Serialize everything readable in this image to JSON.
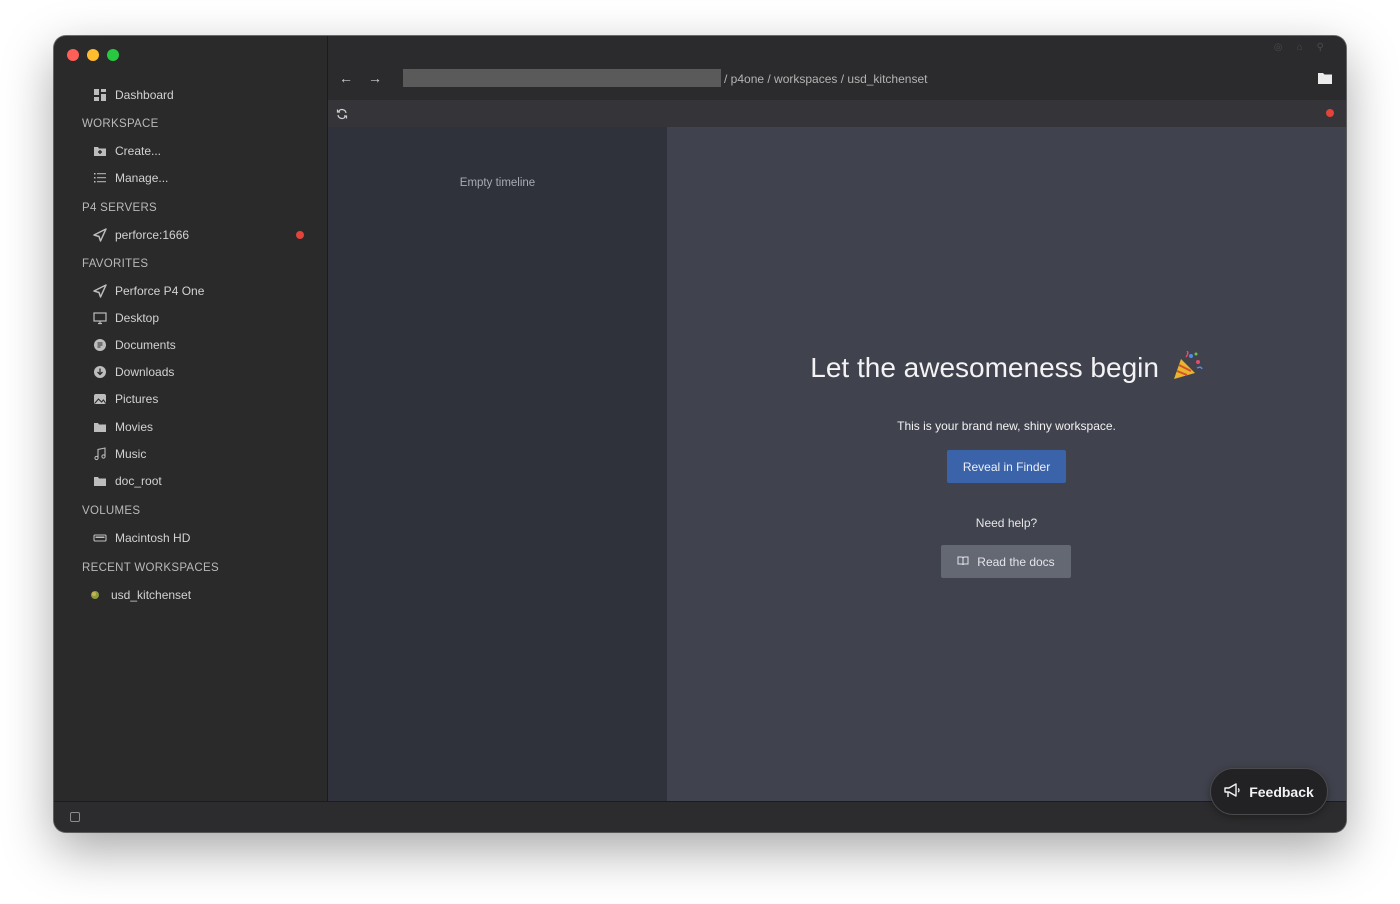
{
  "sidebar": {
    "dashboard": "Dashboard",
    "sections": {
      "workspace": "WORKSPACE",
      "servers": "P4 SERVERS",
      "favorites": "FAVORITES",
      "volumes": "VOLUMES",
      "recent": "RECENT WORKSPACES"
    },
    "workspace_items": [
      "Create...",
      "Manage..."
    ],
    "servers": [
      "perforce:1666"
    ],
    "favorites": [
      "Perforce P4 One",
      "Desktop",
      "Documents",
      "Downloads",
      "Pictures",
      "Movies",
      "Music",
      "doc_root"
    ],
    "volumes": [
      "Macintosh HD"
    ],
    "recent": [
      "usd_kitchenset"
    ]
  },
  "header": {
    "path": "/ p4one / workspaces / usd_kitchenset"
  },
  "timeline": {
    "empty_text": "Empty timeline"
  },
  "main": {
    "title": "Let the awesomeness begin",
    "subtitle": "This is your brand new, shiny workspace.",
    "reveal_button": "Reveal in Finder",
    "help_text": "Need help?",
    "docs_button": "Read the docs"
  },
  "feedback": "Feedback",
  "colors": {
    "accent": "#3b63a9",
    "status_red": "#e2433b"
  },
  "icons": {
    "dashboard": "grid-icon",
    "create": "folder-plus-icon",
    "manage": "list-icon",
    "server": "paper-plane-icon",
    "favorites": [
      "paper-plane-icon",
      "desktop-icon",
      "document-icon",
      "download-icon",
      "picture-icon",
      "folder-icon",
      "music-icon",
      "folder-icon"
    ],
    "volume": "drive-icon",
    "recent": "workspace-icon"
  }
}
